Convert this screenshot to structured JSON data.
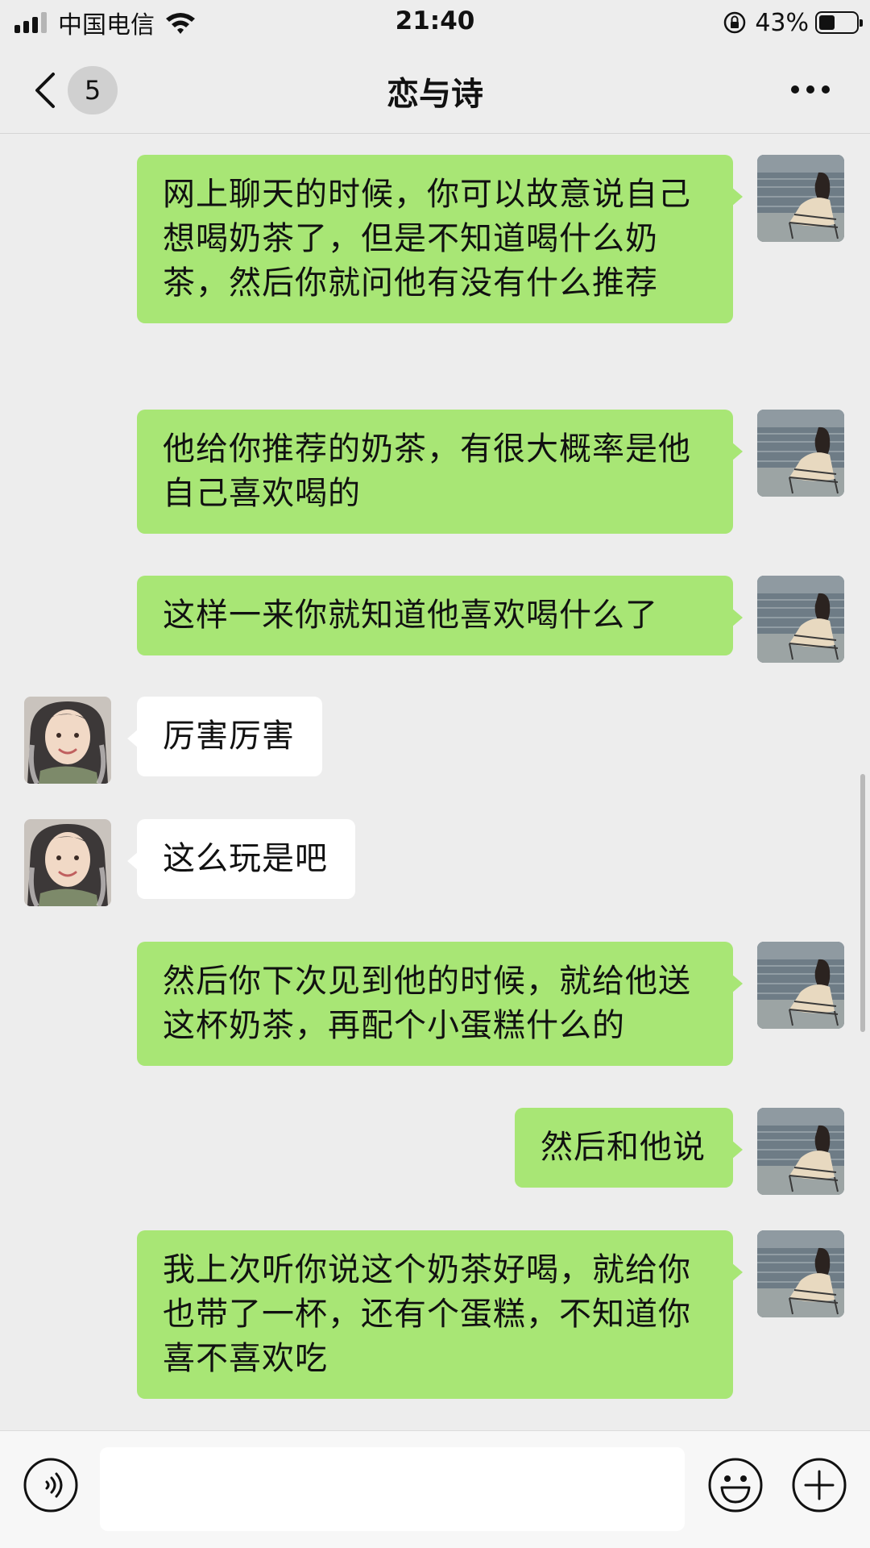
{
  "status_bar": {
    "carrier": "中国电信",
    "time": "21:40",
    "battery_percent": "43%",
    "battery_level": 0.43,
    "icons": [
      "signal-icon",
      "wifi-icon",
      "rotation-lock-icon",
      "battery-icon"
    ]
  },
  "header": {
    "back_icon": "chevron-left-icon",
    "unread_count": "5",
    "title": "恋与诗",
    "more_icon": "more-dots-icon"
  },
  "messages": [
    {
      "sender": "me",
      "text": "网上聊天的时候，你可以故意说自己想喝奶茶了，但是不知道喝什么奶茶，然后你就问他有没有什么推荐"
    },
    {
      "sender": "me",
      "text": "他给你推荐的奶茶，有很大概率是他自己喜欢喝的"
    },
    {
      "sender": "me",
      "text": "这样一来你就知道他喜欢喝什么了"
    },
    {
      "sender": "other",
      "text": "厉害厉害"
    },
    {
      "sender": "other",
      "text": "这么玩是吧"
    },
    {
      "sender": "me",
      "text": "然后你下次见到他的时候，就给他送这杯奶茶，再配个小蛋糕什么的"
    },
    {
      "sender": "me",
      "text": "然后和他说"
    },
    {
      "sender": "me",
      "text": "我上次听你说这个奶茶好喝，就给你也带了一杯，还有个蛋糕，不知道你喜不喜欢吃"
    }
  ],
  "input_bar": {
    "value": "",
    "voice_icon": "voice-icon",
    "emoji_icon": "emoji-icon",
    "plus_icon": "plus-icon"
  },
  "colors": {
    "background": "#ededed",
    "my_bubble": "#a8e675",
    "their_bubble": "#ffffff"
  }
}
